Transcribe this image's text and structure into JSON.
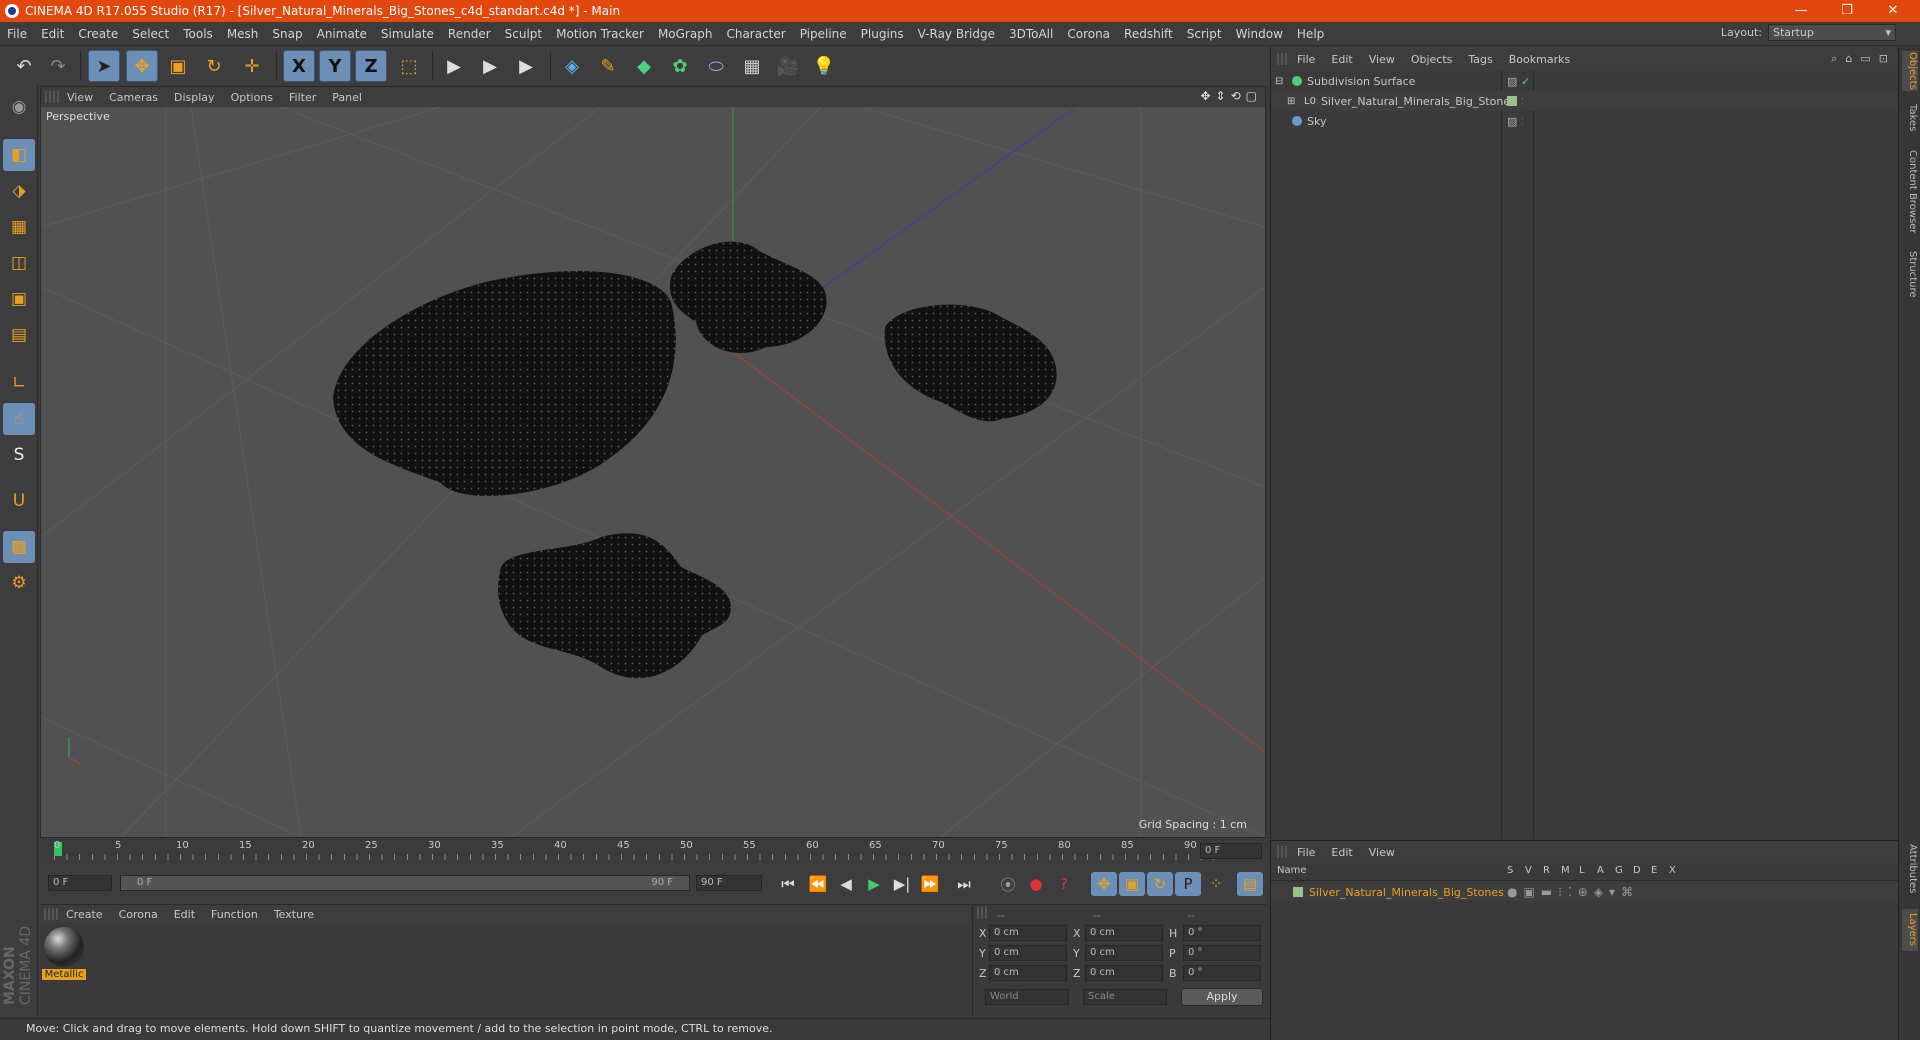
{
  "window": {
    "title": "CINEMA 4D R17.055 Studio (R17) - [Silver_Natural_Minerals_Big_Stones_c4d_standart.c4d *] - Main",
    "minimize": "—",
    "maximize": "❐",
    "close": "✕"
  },
  "menu": [
    "File",
    "Edit",
    "Create",
    "Select",
    "Tools",
    "Mesh",
    "Snap",
    "Animate",
    "Simulate",
    "Render",
    "Sculpt",
    "Motion Tracker",
    "MoGraph",
    "Character",
    "Pipeline",
    "Plugins",
    "V-Ray Bridge",
    "3DToAll",
    "Corona",
    "Redshift",
    "Script",
    "Window",
    "Help"
  ],
  "layout": {
    "label": "Layout:",
    "value": "Startup"
  },
  "toolbar": {
    "undo": "↶",
    "redo": "↷",
    "select": "➤",
    "move": "✥",
    "scale": "▣",
    "rotate": "↻",
    "move2": "✛",
    "x": "X",
    "y": "Y",
    "z": "Z",
    "coord": "⬚",
    "render": "▶",
    "render2": "▶",
    "render3": "▶",
    "cube": "◈",
    "pen": "✎",
    "sub": "◆",
    "clone": "✿",
    "deform": "⬭",
    "floor": "▦",
    "camera": "🎥",
    "light": "💡"
  },
  "lefttools": [
    "◉",
    "◧",
    "⬗",
    "▦",
    "◫",
    "▣",
    "▤",
    "∟",
    "☝",
    "S",
    "U",
    "▩",
    "⚙"
  ],
  "viewport": {
    "menu": [
      "View",
      "Cameras",
      "Display",
      "Options",
      "Filter",
      "Panel"
    ],
    "label": "Perspective",
    "grid_spacing": "Grid Spacing : 1 cm",
    "nav_icons": [
      "✥",
      "⇕",
      "⟲",
      "▢"
    ]
  },
  "timeline": {
    "ticks": [
      "0",
      "5",
      "10",
      "15",
      "20",
      "25",
      "30",
      "35",
      "40",
      "45",
      "50",
      "55",
      "60",
      "65",
      "70",
      "75",
      "80",
      "85",
      "90"
    ],
    "current_frame": "0 F",
    "start_field": "0 F",
    "range_start": "0 F",
    "range_end": "90 F",
    "end_field": "90 F"
  },
  "playback": [
    "⏮",
    "⏪",
    "◀",
    "▶",
    "▶|",
    "⏩",
    "⏭"
  ],
  "material_panel": {
    "menu": [
      "Create",
      "Corona",
      "Edit",
      "Function",
      "Texture"
    ],
    "material_name": "Metallic"
  },
  "coords": {
    "header": [
      "--",
      "--",
      "--"
    ],
    "rows": [
      {
        "a": "X",
        "av": "0 cm",
        "b": "X",
        "bv": "0 cm",
        "c": "H",
        "cv": "0 °"
      },
      {
        "a": "Y",
        "av": "0 cm",
        "b": "Y",
        "bv": "0 cm",
        "c": "P",
        "cv": "0 °"
      },
      {
        "a": "Z",
        "av": "0 cm",
        "b": "Z",
        "bv": "0 cm",
        "c": "B",
        "cv": "0 °"
      }
    ],
    "mode1": "World",
    "mode2": "Scale",
    "apply": "Apply"
  },
  "status": "Move: Click and drag to move elements. Hold down SHIFT to quantize movement / add to the selection in point mode, CTRL to remove.",
  "object_manager": {
    "menu": [
      "File",
      "Edit",
      "View",
      "Objects",
      "Tags",
      "Bookmarks"
    ],
    "objects": [
      {
        "name": "Subdivision Surface",
        "indent": 0,
        "expand": "⊟"
      },
      {
        "name": "Silver_Natural_Minerals_Big_Stones",
        "indent": 1,
        "expand": "⊞"
      },
      {
        "name": "Sky",
        "indent": 0,
        "expand": ""
      }
    ]
  },
  "layer_manager": {
    "menu": [
      "File",
      "Edit",
      "View"
    ],
    "columns": [
      "Name",
      "S",
      "V",
      "R",
      "M",
      "L",
      "A",
      "G",
      "D",
      "E",
      "X"
    ],
    "layer": "Silver_Natural_Minerals_Big_Stones"
  },
  "sidetabs": [
    "Objects",
    "Takes",
    "Content Browser",
    "Structure",
    "Attributes",
    "Layers"
  ],
  "brand": [
    "MAXON",
    "CINEMA 4D"
  ],
  "colors": {
    "accent": "#e2480e",
    "selection": "#6b8fb7",
    "highlight": "#e8a020"
  }
}
